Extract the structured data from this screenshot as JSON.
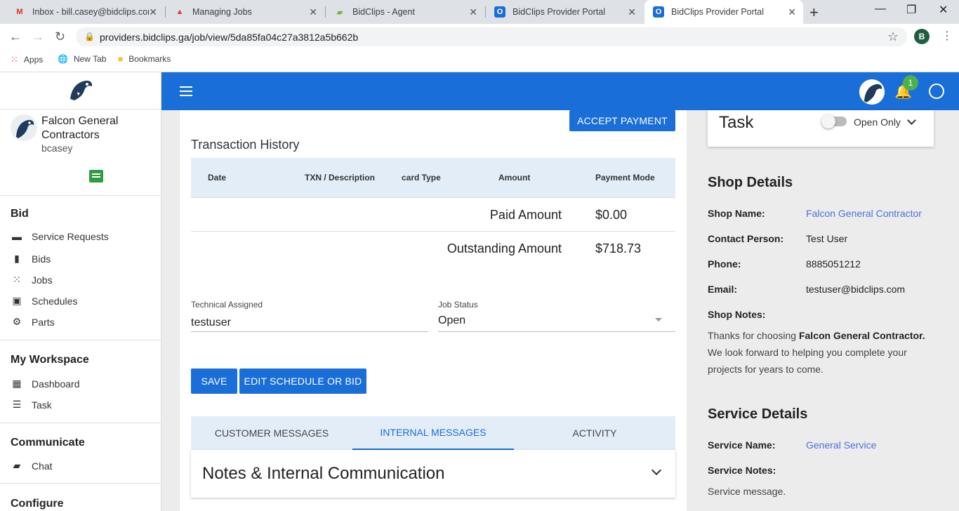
{
  "browser": {
    "tabs": [
      {
        "title": "Inbox - bill.casey@bidclips.com",
        "icon": "gmail-icon"
      },
      {
        "title": "Managing Jobs",
        "icon": "managing-jobs-icon"
      },
      {
        "title": "BidClips - Agent",
        "icon": "bidclips-agent-icon"
      },
      {
        "title": "BidClips Provider Portal",
        "icon": "bidclips-portal-icon"
      },
      {
        "title": "BidClips Provider Portal",
        "icon": "bidclips-portal-icon"
      }
    ],
    "url": "providers.bidclips.ga/job/view/5da85fa04c27a3812a5b662b",
    "profile_initial": "B",
    "bookmarks": [
      "Apps",
      "New Tab",
      "Bookmarks"
    ]
  },
  "sidebar": {
    "company": "Falcon General Contractors",
    "username": "bcasey",
    "sections": [
      {
        "title": "Bid",
        "items": [
          "Service Requests",
          "Bids",
          "Jobs",
          "Schedules",
          "Parts"
        ]
      },
      {
        "title": "My Workspace",
        "items": [
          "Dashboard",
          "Task"
        ]
      },
      {
        "title": "Communicate",
        "items": [
          "Chat"
        ]
      },
      {
        "title": "Configure",
        "items": []
      }
    ]
  },
  "header": {
    "notification_count": "1"
  },
  "main": {
    "accept_payment": "ACCEPT PAYMENT",
    "transaction_title": "Transaction History",
    "columns": [
      "Date",
      "TXN / Description",
      "card Type",
      "Amount",
      "Payment Mode"
    ],
    "paid_label": "Paid Amount",
    "paid_value": "$0.00",
    "outstanding_label": "Outstanding Amount",
    "outstanding_value": "$718.73",
    "tech_label": "Technical Assigned",
    "tech_value": "testuser",
    "status_label": "Job Status",
    "status_value": "Open",
    "save": "SAVE",
    "edit": "EDIT SCHEDULE OR BID",
    "tabs": [
      "CUSTOMER MESSAGES",
      "INTERNAL MESSAGES",
      "ACTIVITY"
    ],
    "notes_title": "Notes & Internal Communication"
  },
  "right": {
    "task_title": "Task",
    "toggle_label": "Open Only",
    "shop_heading": "Shop Details",
    "shop_name_label": "Shop Name:",
    "shop_name": "Falcon General Contractor",
    "contact_label": "Contact Person:",
    "contact": "Test User",
    "phone_label": "Phone:",
    "phone": "8885051212",
    "email_label": "Email:",
    "email": "testuser@bidclips.com",
    "notes_label": "Shop Notes:",
    "notes_pre": "Thanks for choosing ",
    "notes_bold": "Falcon General Contractor.",
    "notes_post": " We look forward to helping you complete your projects for years to come.",
    "service_heading": "Service Details",
    "service_name_label": "Service Name:",
    "service_name": "General Service",
    "service_notes_label": "Service Notes:",
    "service_notes": "Service message."
  }
}
